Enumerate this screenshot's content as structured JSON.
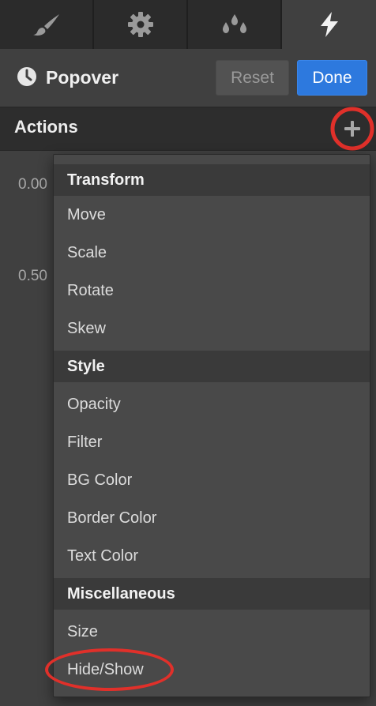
{
  "tabs": [
    {
      "icon": "paintbrush-icon",
      "active": false
    },
    {
      "icon": "gear-icon",
      "active": false
    },
    {
      "icon": "drops-icon",
      "active": false
    },
    {
      "icon": "lightning-icon",
      "active": true
    }
  ],
  "header": {
    "title": "Popover",
    "icon": "clock-icon",
    "reset_label": "Reset",
    "done_label": "Done"
  },
  "actions": {
    "label": "Actions",
    "add_icon": "plus-icon"
  },
  "background_values": [
    "0.00",
    "0.50"
  ],
  "menu": {
    "sections": [
      {
        "title": "Transform",
        "items": [
          "Move",
          "Scale",
          "Rotate",
          "Skew"
        ]
      },
      {
        "title": "Style",
        "items": [
          "Opacity",
          "Filter",
          "BG Color",
          "Border Color",
          "Text Color"
        ]
      },
      {
        "title": "Miscellaneous",
        "items": [
          "Size",
          "Hide/Show"
        ]
      }
    ]
  },
  "colors": {
    "accent": "#2d79de",
    "highlight": "#e0302a",
    "panel": "#404040",
    "menu": "#494949"
  }
}
